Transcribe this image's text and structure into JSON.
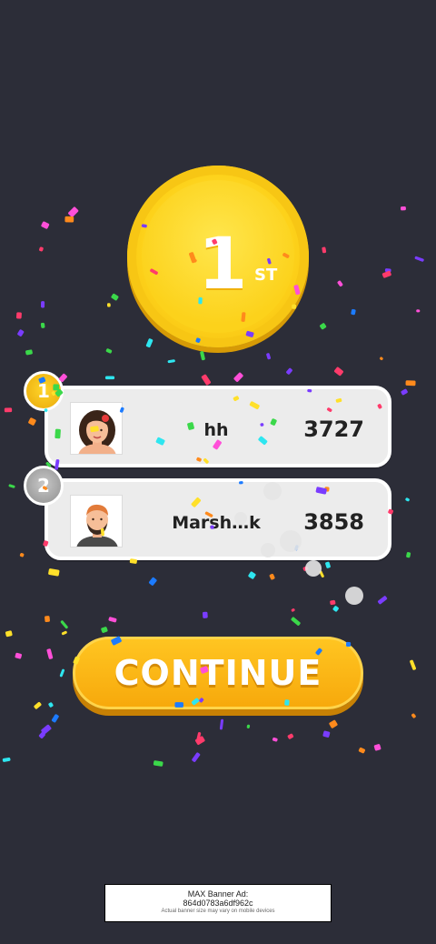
{
  "medal": {
    "rank": "1",
    "suffix": "ST"
  },
  "leaderboard": [
    {
      "rank": "1",
      "name": "hh",
      "score": "3727",
      "avatar": "avatar-woman-icon"
    },
    {
      "rank": "2",
      "name": "Marsh…k",
      "score": "3858",
      "avatar": "avatar-man-icon"
    }
  ],
  "continue_button": {
    "label": "CONTINUE"
  },
  "ad": {
    "title": "MAX Banner Ad:",
    "id": "864d0783a6df962c",
    "note": "Actual banner size may vary on mobile devices"
  },
  "colors": {
    "background": "#2c2d38",
    "gold": "#fdd21a",
    "silver": "#a9a9a9",
    "button": "#f7a90c"
  }
}
